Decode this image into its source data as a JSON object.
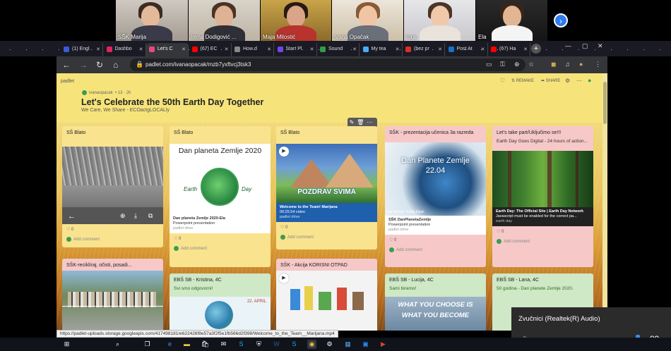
{
  "call": {
    "participants": [
      {
        "name": "SŠK Marija"
      },
      {
        "name": "Irena Dodigović ..."
      },
      {
        "name": "Maja Milostić"
      },
      {
        "name": "Ivana Opačak"
      },
      {
        "name": "Iora"
      },
      {
        "name": "Ela"
      }
    ],
    "next_icon": "chevron-right-icon"
  },
  "browser": {
    "tabs": [
      {
        "label": "(1) Engl",
        "color": "#3b5bdb"
      },
      {
        "label": "Dashbo",
        "color": "#e0245e"
      },
      {
        "label": "Let's C",
        "color": "#e64980",
        "active": true
      },
      {
        "label": "(67) EC",
        "color": "#ff0000"
      },
      {
        "label": "How d",
        "color": "#888888"
      },
      {
        "label": "Start Pl",
        "color": "#7048e8"
      },
      {
        "label": "Sound",
        "color": "#2f9e44"
      },
      {
        "label": "My tea",
        "color": "#4dabf7"
      },
      {
        "label": "(bez pr",
        "color": "#d93025"
      },
      {
        "label": "Post At",
        "color": "#1971c2"
      },
      {
        "label": "(67) Ha",
        "color": "#ff0000"
      }
    ],
    "url": "padlet.com/ivanaopacak/mzb7yxftvcj3tsk3",
    "new_tab": "+"
  },
  "padlet": {
    "logo": "padlet",
    "author": "ivanaopacak",
    "author_meta": "13 · 2h",
    "title": "Let's Celebrate the 50th Earth Day Together",
    "subtitle": "We Care, We Share - ECOactgLOCALly",
    "actions": {
      "remake": "REMAKE",
      "share": "SHARE"
    },
    "add_comment": "Add comment",
    "likes": "0",
    "columns": [
      {
        "cards": [
          {
            "title": "SŠ Blato",
            "color": "yellow",
            "media": "gallery"
          },
          {
            "title": "SŠK-reciklíraj, očisti, posadi...",
            "color": "pink",
            "media": "group-photo"
          }
        ]
      },
      {
        "cards": [
          {
            "title": "SŠ Blato",
            "color": "yellow",
            "media": "earthday-pdf",
            "media_title": "Dan planeta Zemlje 2020",
            "cap_title": "Dan planeta Zemlje 2020-Ela",
            "cap_type": "Powerpoint presentation",
            "cap_src": "padlet drive"
          },
          {
            "title": "EBŠ SB - Kristina, 4C",
            "color": "green",
            "text": "Svi smo odgovorni!"
          }
        ]
      },
      {
        "cards": [
          {
            "title": "SŠ Blato",
            "color": "yellow",
            "media": "video",
            "media_title": "POZDRAV SVIMA",
            "cap_title": "Welcome to the Team! Marijana",
            "cap_type": "00:25.54 video",
            "cap_src": "padlet drive"
          },
          {
            "title": "SŠK - Akcija KORISNI OTPAD",
            "color": "pink",
            "media": "waste"
          }
        ]
      },
      {
        "cards": [
          {
            "title": "SŠK - prezentacija učenica 3a razreda",
            "color": "pink",
            "media": "globe",
            "media_title": "Dan Planete Zemlje",
            "media_date": "22.04",
            "media_credit": "Lea Mohač i Karla Kljaić",
            "cap_title": "SŠK DanPlanetaZemlje",
            "cap_type": "Powerpoint presentation",
            "cap_src": "padlet drive"
          },
          {
            "title": "EBŠ SB - Lucija, 4C",
            "color": "green",
            "text": "Sami biramo!",
            "banner": "WHAT YOU CHOOSE IS WHAT YOU BECOME"
          }
        ]
      },
      {
        "cards": [
          {
            "title": "Let's take part/Uključimo se!!!",
            "color": "pink",
            "text": "Earth Day Goes Digital - 24 hours of action...",
            "media": "forest",
            "cap_title": "Earth Day: The Official Site | Earth Day Network",
            "cap_type": "Javascript must be enabled for the correct pa...",
            "cap_src": "earth day"
          },
          {
            "title": "EBŠ SB - Lana, 4C",
            "color": "green",
            "text": "50 godina - Dan planete Zemlje 2020."
          }
        ]
      }
    ]
  },
  "status_url": "https://padlet-uploads.storage.googleapis.com/417498181/e622426f8e57a3f2f5e1fb566d2f398/Welcome_to_the_Team__Marijana.mp4",
  "volume": {
    "device": "Zvučnici (Realtek(R) Audio)",
    "level": 89,
    "level_fraction": 0.89,
    "icon": "speaker-icon"
  },
  "colors": {
    "padlet_bg": "#f6e47a",
    "card_yellow": "#f9e38e",
    "card_pink": "#f7c8c8",
    "card_green": "#cfe8c6",
    "accent_blue": "#3b8eea"
  }
}
